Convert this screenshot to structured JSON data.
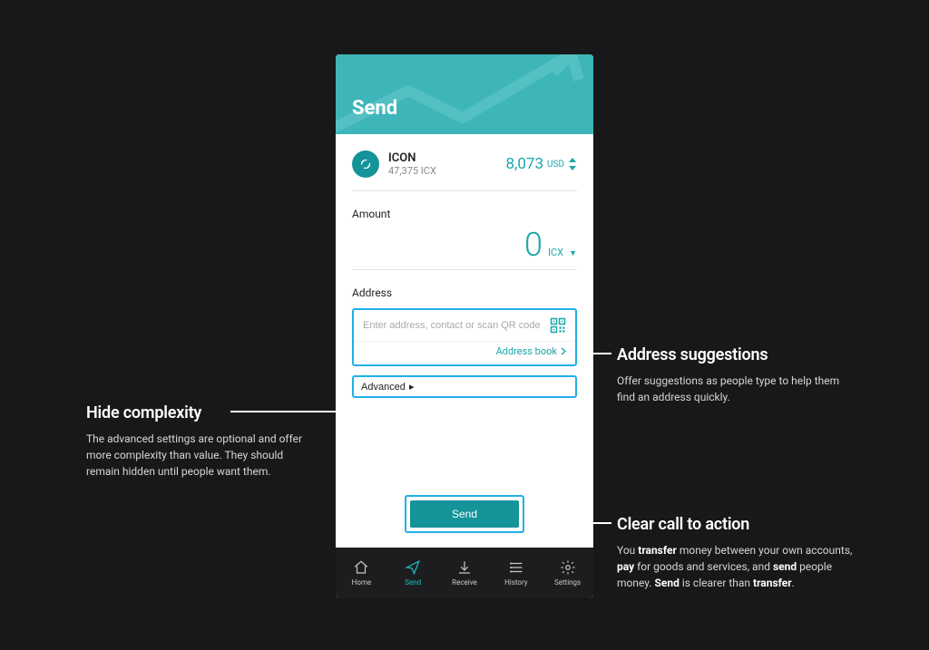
{
  "header": {
    "title": "Send"
  },
  "balance": {
    "coin_name": "ICON",
    "coin_amount": "47,375 ICX",
    "fiat_value": "8,073",
    "fiat_currency": "USD"
  },
  "amount": {
    "label": "Amount",
    "value": "0",
    "unit": "ICX"
  },
  "address": {
    "label": "Address",
    "placeholder": "Enter address, contact or scan QR code",
    "book_label": "Address book"
  },
  "advanced": {
    "label": "Advanced"
  },
  "cta": {
    "label": "Send"
  },
  "tabs": {
    "home": "Home",
    "send": "Send",
    "receive": "Receive",
    "history": "History",
    "settings": "Settings"
  },
  "callouts": {
    "left": {
      "title": "Hide complexity",
      "body": "The advanced settings are optional and offer more complexity than value. They should remain hidden until people want them."
    },
    "right_top": {
      "title": "Address suggestions",
      "body": "Offer suggestions as people type to help them find an address quickly."
    },
    "right_bottom": {
      "title": "Clear call to action",
      "body_1": "You ",
      "body_b1": "transfer",
      "body_2": " money between your own accounts, ",
      "body_b2": "pay",
      "body_3": " for goods and services, and ",
      "body_b3": "send",
      "body_4": " people money. ",
      "body_b4": "Send",
      "body_5": " is clearer than ",
      "body_b5": "transfer",
      "body_6": "."
    }
  }
}
